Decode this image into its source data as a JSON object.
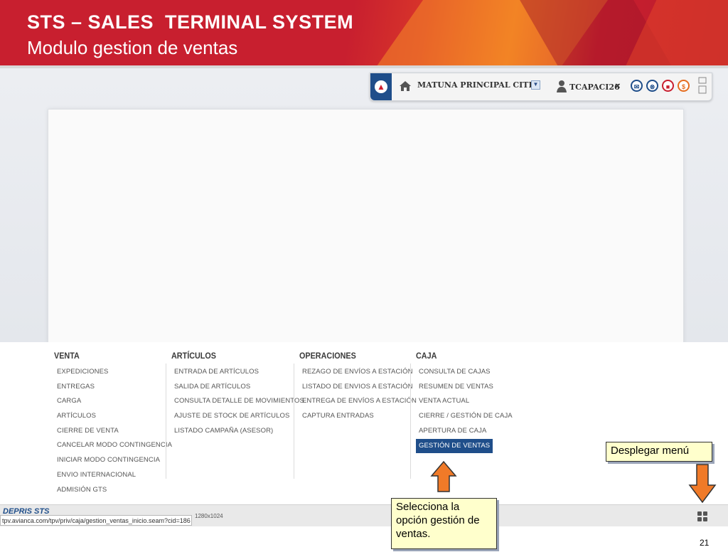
{
  "slide": {
    "title": "STS – SALES  TERMINAL SYSTEM",
    "subtitle": "Modulo gestion de ventas",
    "page_number": "21"
  },
  "topbar": {
    "branch": "MATUNA PRINCIPAL CITIBAN",
    "user": "TCAPACI26",
    "close": "×",
    "buttons": [
      "mail-icon",
      "cancel-icon",
      "lock-icon",
      "dollar-icon"
    ]
  },
  "menu": {
    "venta": {
      "title": "VENTA",
      "items": [
        "EXPEDICIONES",
        "ENTREGAS",
        "CARGA",
        "ARTÍCULOS",
        "CIERRE DE VENTA",
        "CANCELAR MODO CONTINGENCIA",
        "INICIAR MODO CONTINGENCIA",
        "ENVIO INTERNACIONAL",
        "ADMISIÓN GTS"
      ]
    },
    "articulos": {
      "title": "ARTÍCULOS",
      "items": [
        "ENTRADA DE ARTÍCULOS",
        "SALIDA DE ARTÍCULOS",
        "CONSULTA DETALLE DE MOVIMIENTOS",
        "AJUSTE DE STOCK DE ARTÍCULOS",
        "LISTADO CAMPAÑA (ASESOR)"
      ]
    },
    "operaciones": {
      "title": "OPERACIONES",
      "items": [
        "REZAGO DE ENVÍOS A ESTACIÓN",
        "LISTADO DE ENVIOS A ESTACIÓN",
        "ENTREGA DE ENVÍOS A ESTACIÓN",
        "CAPTURA ENTRADAS"
      ]
    },
    "caja": {
      "title": "CAJA",
      "items": [
        "CONSULTA DE CAJAS",
        "RESUMEN DE VENTAS",
        "VENTA ACTUAL",
        "CIERRE / GESTIÓN DE CAJA",
        "APERTURA DE CAJA",
        "GESTIÓN DE VENTAS"
      ],
      "selected_index": 5
    }
  },
  "statusbar": {
    "logo": "DEPRIS STS",
    "url": "tpv.avianca.com/tpv/priv/caja/gestion_ventas_inicio.seam?cid=186",
    "resolution": "1280x1024"
  },
  "callouts": {
    "menu": "Desplegar menú",
    "select": "Selecciona la opción gestión de ventas."
  },
  "colors": {
    "banner_red": "#c81f2f",
    "banner_orange": "#ee7a22",
    "accent_blue": "#1f4e8a",
    "arrow_orange": "#f07a28",
    "callout_fill": "#ffffcc"
  }
}
